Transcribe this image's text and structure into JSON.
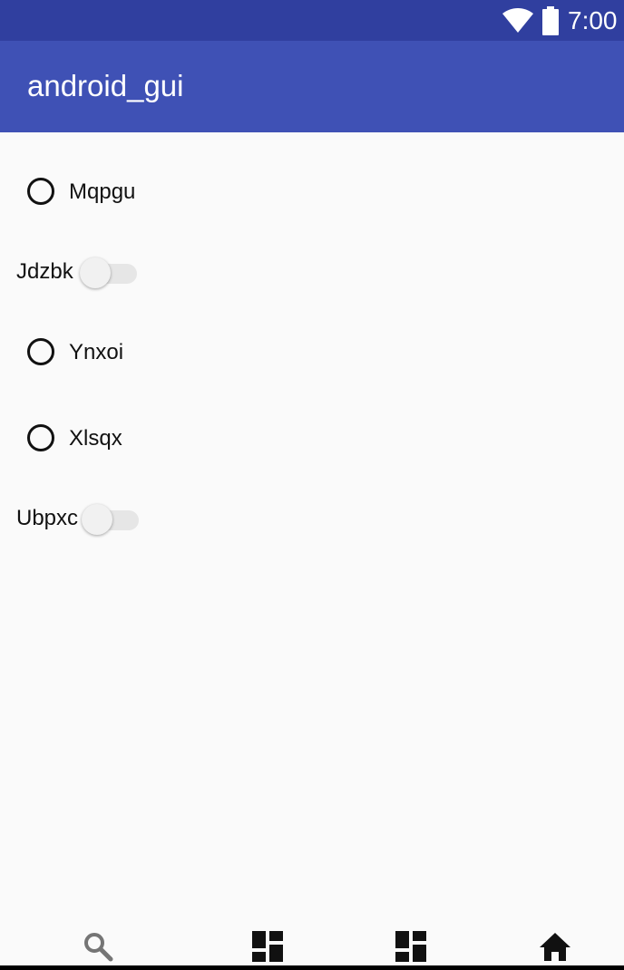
{
  "status_bar": {
    "time": "7:00",
    "icons": [
      "wifi-icon",
      "battery-icon"
    ]
  },
  "app_bar": {
    "title": "android_gui",
    "background": "#3f51b5",
    "status_background": "#303f9f"
  },
  "controls": [
    {
      "type": "radio",
      "label": "Mqpgu",
      "checked": false
    },
    {
      "type": "switch",
      "label": "Jdzbk",
      "on": false
    },
    {
      "type": "radio",
      "label": "Ynxoi",
      "checked": false
    },
    {
      "type": "radio",
      "label": "Xlsqx",
      "checked": false
    },
    {
      "type": "switch",
      "label": "Ubpxc",
      "on": false
    }
  ],
  "bottom_nav": {
    "items": [
      "search-icon",
      "dashboard-icon",
      "dashboard-icon",
      "home-icon"
    ]
  }
}
